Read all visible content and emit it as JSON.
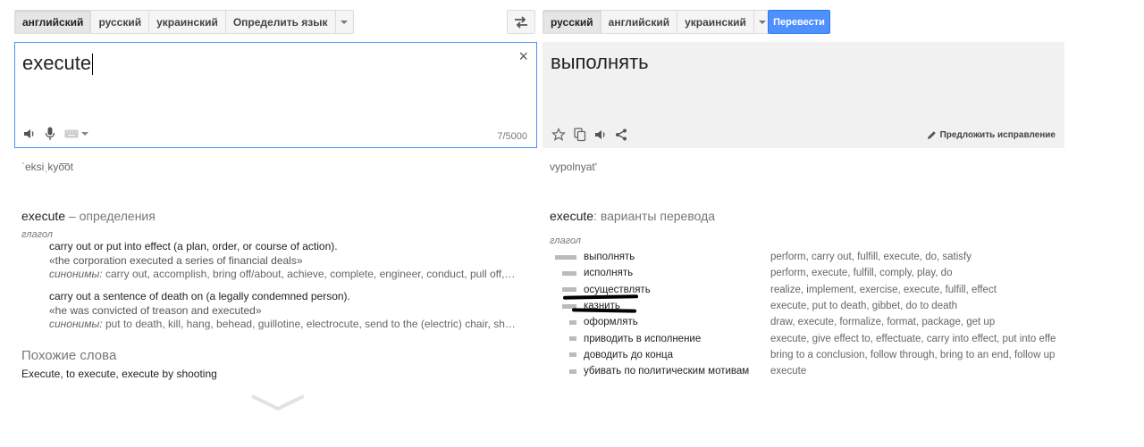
{
  "source_langs": [
    "английский",
    "русский",
    "украинский",
    "Определить язык"
  ],
  "target_langs": [
    "русский",
    "английский",
    "украинский"
  ],
  "translate_label": "Перевести",
  "source": {
    "text": "execute",
    "counter": "7/5000",
    "clear": "×",
    "transliteration": "ˈeksiˌkyo͞ot"
  },
  "target": {
    "text": "выполнять",
    "transliteration": "vypolnyat'",
    "suggest_label": "Предложить исправление"
  },
  "definitions": {
    "word": "execute",
    "heading_suffix": " – определения",
    "pos": "глагол",
    "entries": [
      {
        "gloss": "carry out or put into effect (a plan, order, or course of action).",
        "example": "«the corporation executed a series of financial deals»",
        "synonyms_label": "синонимы:",
        "synonyms": " carry out, accomplish, bring off/about, achieve, complete, engineer, conduct, pull off,…"
      },
      {
        "gloss": "carry out a sentence of death on (a legally condemned person).",
        "example": "«he was convicted of treason and executed»",
        "synonyms_label": "синонимы:",
        "synonyms": " put to death, kill, hang, behead, guillotine, electrocute, send to the (electric) chair, sh…"
      }
    ]
  },
  "similar": {
    "heading": "Похожие слова",
    "text": "Execute, to execute, execute by shooting"
  },
  "translations": {
    "word": "execute",
    "heading_suffix": ": варианты перевода",
    "pos": "глагол",
    "rows": [
      {
        "word": "выполнять",
        "freq": 1.0,
        "back": "perform, carry out, fulfill, execute, do, satisfy"
      },
      {
        "word": "исполнять",
        "freq": 0.66,
        "back": "perform, execute, fulfill, comply, play, do"
      },
      {
        "word": "осуществлять",
        "freq": 0.66,
        "back": "realize, implement, exercise, execute, fulfill, effect"
      },
      {
        "word": "казнить",
        "freq": 0.66,
        "back": "execute, put to death, gibbet, do to death"
      },
      {
        "word": "оформлять",
        "freq": 0.33,
        "back": "draw, execute, formalize, format, package, get up"
      },
      {
        "word": "приводить в исполнение",
        "freq": 0.33,
        "back": "execute, give effect to, effectuate, carry into effect, put into effe"
      },
      {
        "word": "доводить до конца",
        "freq": 0.33,
        "back": "bring to a conclusion, follow through, bring to an end, follow up"
      },
      {
        "word": "убивать по политическим мотивам",
        "freq": 0.33,
        "back": "execute"
      }
    ]
  }
}
